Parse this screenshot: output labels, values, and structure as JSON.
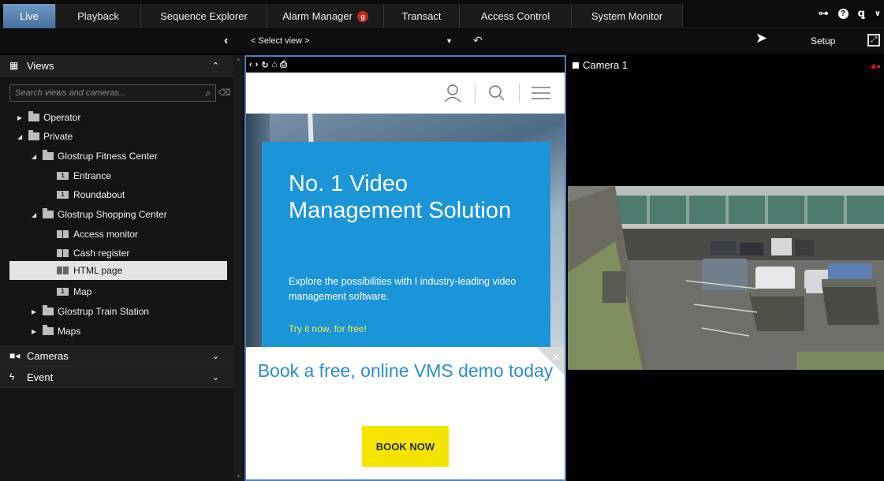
{
  "tabs": [
    {
      "label": "Live",
      "active": true
    },
    {
      "label": "Playback"
    },
    {
      "label": "Sequence Explorer"
    },
    {
      "label": "Alarm Manager",
      "badge": "g"
    },
    {
      "label": "Transact"
    },
    {
      "label": "Access Control"
    },
    {
      "label": "System Monitor"
    }
  ],
  "top_icons": [
    "connection-icon",
    "help-icon",
    "key-icon",
    "chevron-down-icon"
  ],
  "subbar": {
    "select_view": "< Select view >",
    "setup_label": "Setup"
  },
  "sidebar": {
    "views_header": "Views",
    "search_placeholder": "Search views and cameras...",
    "tree": [
      {
        "label": "Operator",
        "type": "folder",
        "expanded": false
      },
      {
        "label": "Private",
        "type": "folder",
        "expanded": true
      },
      {
        "label": "Glostrup Fitness Center",
        "type": "folder",
        "expanded": true
      },
      {
        "label": "Entrance",
        "type": "view-single",
        "badge": "1"
      },
      {
        "label": "Roundabout",
        "type": "view-single",
        "badge": "1"
      },
      {
        "label": "Glostrup Shopping Center",
        "type": "folder",
        "expanded": true
      },
      {
        "label": "Access monitor",
        "type": "view-split"
      },
      {
        "label": "Cash register",
        "type": "view-split"
      },
      {
        "label": "HTML page",
        "type": "view-split",
        "selected": true
      },
      {
        "label": "Map",
        "type": "view-single",
        "badge": "1"
      },
      {
        "label": "Glostrup Train Station",
        "type": "folder",
        "expanded": false
      },
      {
        "label": "Maps",
        "type": "folder",
        "expanded": false
      }
    ],
    "cameras_header": "Cameras",
    "event_header": "Event"
  },
  "browser": {
    "hero_title": "No. 1 Video Management Solution",
    "hero_text": "Explore the possibilities with I industry-leading video management software.",
    "hero_link": "Try it now, for free!",
    "promo_title": "Book a free, online VMS demo today",
    "promo_button": "BOOK NOW"
  },
  "camera": {
    "title": "Camera 1"
  },
  "colors": {
    "accent": "#1b95d8",
    "active_tab": "#5b83b2",
    "book_button": "#f5e400",
    "link_yellow": "#f4e94a"
  }
}
